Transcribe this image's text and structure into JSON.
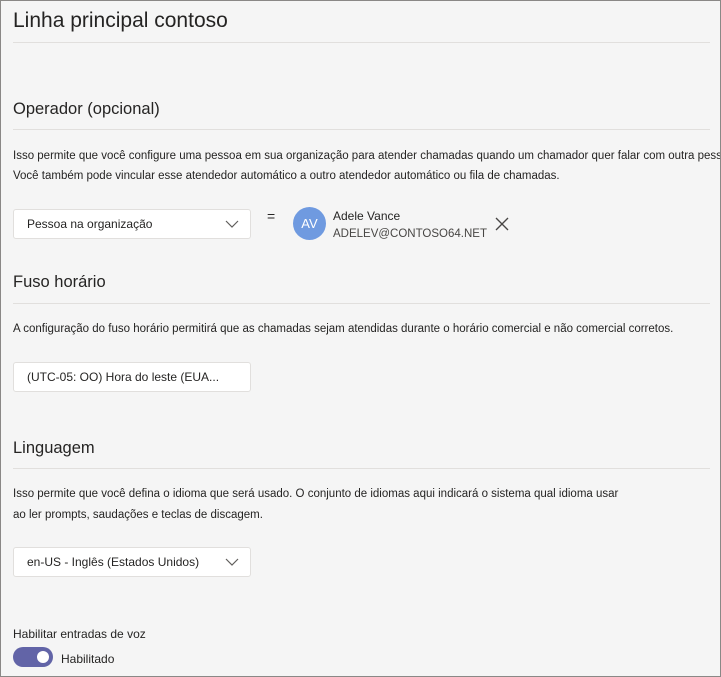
{
  "page": {
    "title": "Linha principal contoso"
  },
  "operator": {
    "title": "Operador (opcional)",
    "description_line1": "Isso permite que você configure uma pessoa em sua organização para atender chamadas quando um chamador quer falar com outra pessoa.",
    "description_line2": "Você também pode vincular esse atendedor automático a outro atendedor automático ou fila de chamadas.",
    "dropdown_value": "Pessoa na organização",
    "equals": "=",
    "user": {
      "initials": "AV",
      "name": "Adele Vance",
      "email": "ADELEV@CONTOSO64.NET",
      "avatar_color": "#6f9ae0"
    },
    "remove_icon": "close-icon"
  },
  "timezone": {
    "title": "Fuso horário",
    "description": "A configuração do fuso horário permitirá que as chamadas sejam atendidas durante o horário comercial e não comercial corretos.",
    "dropdown_value": "(UTC-05: OO) Hora do leste (EUA..."
  },
  "language": {
    "title": "Linguagem",
    "description_line1": "Isso permite que você defina o idioma que será usado. O conjunto de idiomas aqui indicará o sistema qual idioma usar",
    "description_line2": "ao ler prompts, saudações e teclas de discagem.",
    "dropdown_value": "en-US - Inglês (Estados Unidos)"
  },
  "voice_input": {
    "label": "Habilitar entradas de voz",
    "state_label": "Habilitado",
    "enabled": true,
    "accent_color": "#6264a7"
  }
}
